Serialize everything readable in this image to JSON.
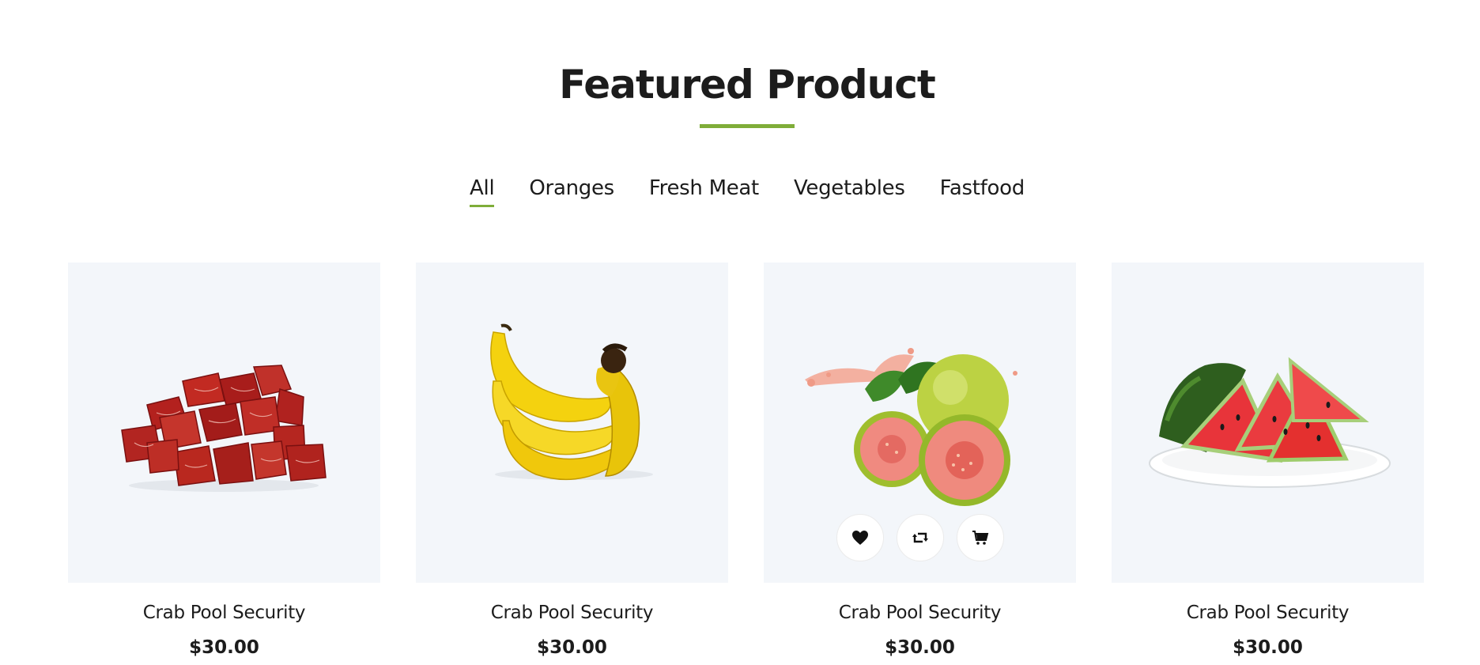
{
  "section": {
    "title": "Featured Product",
    "accent_color": "#7fad39"
  },
  "filters": [
    {
      "label": "All",
      "active": true
    },
    {
      "label": "Oranges",
      "active": false
    },
    {
      "label": "Fresh Meat",
      "active": false
    },
    {
      "label": "Vegetables",
      "active": false
    },
    {
      "label": "Fastfood",
      "active": false
    }
  ],
  "products": [
    {
      "name": "Crab Pool Security",
      "price": "$30.00",
      "image": "beef-cubes"
    },
    {
      "name": "Crab Pool Security",
      "price": "$30.00",
      "image": "bananas"
    },
    {
      "name": "Crab Pool Security",
      "price": "$30.00",
      "image": "guavas",
      "hover_actions": [
        "heart-icon",
        "retweet-icon",
        "cart-icon"
      ]
    },
    {
      "name": "Crab Pool Security",
      "price": "$30.00",
      "image": "watermelon"
    }
  ]
}
